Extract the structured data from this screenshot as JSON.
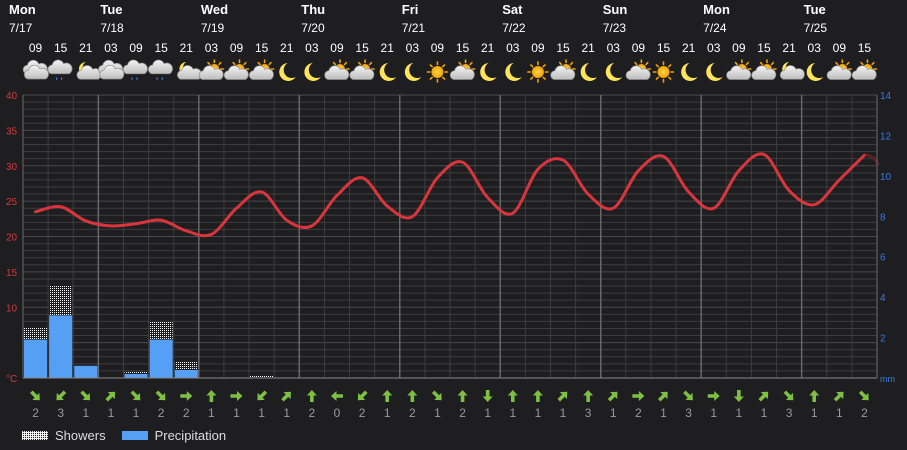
{
  "chart_data": {
    "type": "line",
    "days": [
      {
        "name": "Mon",
        "date": "7/17"
      },
      {
        "name": "Tue",
        "date": "7/18"
      },
      {
        "name": "Wed",
        "date": "7/19"
      },
      {
        "name": "Thu",
        "date": "7/20"
      },
      {
        "name": "Fri",
        "date": "7/21"
      },
      {
        "name": "Sat",
        "date": "7/22"
      },
      {
        "name": "Sun",
        "date": "7/23"
      },
      {
        "name": "Mon",
        "date": "7/24"
      },
      {
        "name": "Tue",
        "date": "7/25"
      }
    ],
    "hours": [
      "09",
      "15",
      "21",
      "03",
      "09",
      "15",
      "21",
      "03",
      "09",
      "15",
      "21",
      "03",
      "09",
      "15",
      "21",
      "03",
      "09",
      "15",
      "21",
      "03",
      "09",
      "15",
      "21",
      "03",
      "09",
      "15",
      "21",
      "03",
      "09",
      "15",
      "21",
      "03",
      "09",
      "15"
    ],
    "icons": [
      "cloudy",
      "cloudy-rain",
      "partly-cloudy-night",
      "cloudy",
      "cloudy-rain",
      "cloudy-rain",
      "partly-cloudy-night",
      "cloudy-sun",
      "cloudy-sun",
      "cloudy-sun",
      "moon",
      "moon",
      "cloudy-sun",
      "cloudy-sun",
      "moon",
      "moon",
      "sun",
      "cloudy-sun",
      "moon",
      "moon",
      "sun",
      "cloudy-sun",
      "moon",
      "moon",
      "cloudy-sun",
      "sun",
      "moon",
      "moon",
      "cloudy-sun",
      "cloudy-sun",
      "partly-cloudy-night",
      "moon",
      "cloudy-sun",
      "cloudy-sun"
    ],
    "temperature": [
      23.5,
      24.2,
      22.2,
      21.5,
      21.8,
      22.3,
      20.8,
      20.3,
      24.0,
      26.3,
      22.3,
      21.5,
      25.8,
      28.3,
      24.3,
      22.8,
      28.3,
      30.5,
      25.5,
      23.3,
      29.5,
      30.8,
      26.0,
      24.0,
      29.3,
      31.3,
      26.3,
      24.0,
      29.3,
      31.6,
      26.5,
      24.5,
      28.0,
      31.5
    ],
    "precipitation": [
      1.9,
      3.1,
      0.6,
      0,
      0.2,
      1.9,
      0.4,
      0,
      0,
      0,
      0,
      0,
      0,
      0,
      0,
      0,
      0,
      0,
      0,
      0,
      0,
      0,
      0,
      0,
      0,
      0,
      0,
      0,
      0,
      0,
      0,
      0,
      0,
      0
    ],
    "showers": [
      0.6,
      1.5,
      0,
      0,
      0.1,
      0.9,
      0.4,
      0.05,
      0,
      0.1,
      0,
      0,
      0,
      0,
      0,
      0,
      0,
      0,
      0,
      0,
      0,
      0,
      0,
      0,
      0,
      0,
      0,
      0,
      0,
      0,
      0,
      0,
      0,
      0
    ],
    "wind_direction": [
      "SE",
      "SW",
      "SE",
      "NE",
      "SE",
      "SE",
      "E",
      "N",
      "E",
      "SW",
      "NE",
      "N",
      "W",
      "SW",
      "N",
      "N",
      "SE",
      "N",
      "S",
      "N",
      "N",
      "NE",
      "N",
      "NE",
      "E",
      "NE",
      "SE",
      "E",
      "S",
      "NE",
      "SE",
      "N",
      "NE",
      "SE"
    ],
    "wind_speed": [
      2,
      3,
      1,
      1,
      1,
      2,
      2,
      1,
      1,
      1,
      1,
      2,
      0,
      2,
      1,
      2,
      1,
      2,
      1,
      1,
      1,
      1,
      3,
      1,
      2,
      1,
      3,
      1,
      1,
      1,
      3,
      1,
      1,
      2
    ],
    "y_left": {
      "ticks": [
        40,
        35,
        30,
        25,
        20,
        15,
        10
      ],
      "unit": "°C",
      "ylim": [
        0,
        40
      ]
    },
    "y_right": {
      "ticks": [
        14,
        12,
        10,
        8,
        6,
        4,
        2
      ],
      "unit": "mm",
      "ylim": [
        0,
        14
      ]
    },
    "legend": [
      {
        "label": "Showers",
        "kind": "showers"
      },
      {
        "label": "Precipitation",
        "kind": "precipitation"
      }
    ],
    "colors": {
      "background": "#1e1e20",
      "temperature_line": "#d8353d",
      "precipitation": "#55a0f5",
      "showers": "#ffffff",
      "grid": "#3d3d40",
      "day_divider": "#6a6a6e",
      "left_axis": "#cf3b3b",
      "right_axis": "#3a78e0",
      "wind_arrow": "#7ec043",
      "wind_speed_text": "#9a9a9a"
    }
  }
}
